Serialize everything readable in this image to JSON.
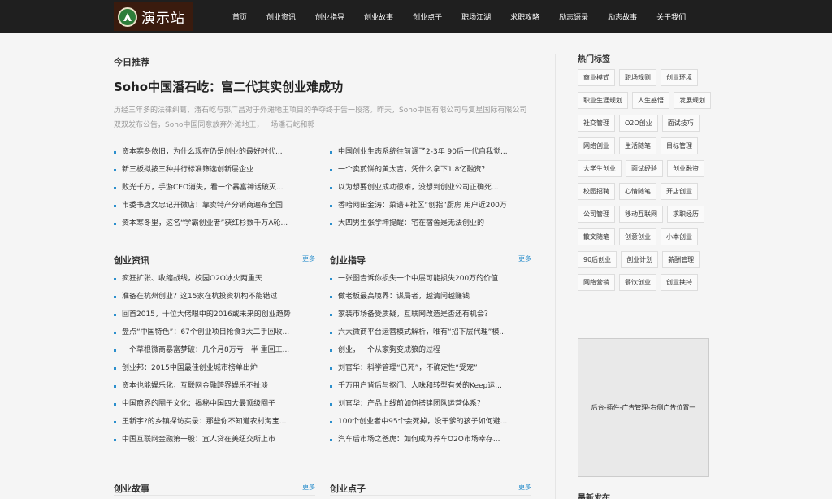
{
  "logo": {
    "text": "演示站"
  },
  "nav": [
    "首页",
    "创业资讯",
    "创业指导",
    "创业故事",
    "创业点子",
    "职场江湖",
    "求职攻略",
    "励志语录",
    "励志故事",
    "关于我们"
  ],
  "recommend": {
    "title": "今日推荐",
    "headline": "Soho中国潘石屹：富二代其实创业难成功",
    "summary": "历经三年多的法律纠葛，潘石屹与郭广昌对于外滩地王项目的争夺终于告一段落。昨天，Soho中国有限公司与复星国际有限公司双双发布公告，Soho中国同意放弃外滩地王，一场潘石屹和郭",
    "left": [
      "资本寒冬依旧，为什么现在仍是创业的最好时代...",
      "新三板拟按三种并行标准筛选创新层企业",
      "败光千万，手游CEO消失，看一个暴富神话破灭...",
      "市委书唐文忠记开微店！靠卖特产分销商遍布全国",
      "资本寒冬里，这名“学霸创业者”获红杉数千万A轮..."
    ],
    "right": [
      "中国创业生态系统往前调了2-3年 90后一代自我觉...",
      "一个卖煎饼的黄太吉，凭什么拿下1.8亿融资？",
      "以为想要创业成功很难，没想到创业公司正确死...",
      "香哈网田金涛：菜谱+社区“创指”厨房 用户近200万",
      "大四男生张学坤提醒：宅在宿舍是无法创业的"
    ]
  },
  "sections": [
    {
      "title": "创业资讯",
      "more": "更多",
      "items": [
        "疯狂扩张、收缩战线，校园O2O冰火两重天",
        "准备在杭州创业？这15家在杭投资机构不能错过",
        "回首2015，十位大佬眼中的2016或未来的创业趋势",
        "盘点“中国特色”：67个创业项目抢食3大二手回收...",
        "一个草根微商暴富梦破：几个月8万亏一半 重回工...",
        "创业邦：2015中国最佳创业城市榜单出炉",
        "资本也能娱乐化，互联网金融跨界娱乐不扯淡",
        "中国商界的圈子文化：揭秘中国四大最顶级圈子",
        "王新宇?的乡镇探访实录：那些你不知道农村淘宝...",
        "中国互联网金融第一股：宜人贷在美纽交所上市"
      ]
    },
    {
      "title": "创业指导",
      "more": "更多",
      "items": [
        "一张图告诉你损失一个中层可能损失200万的价值",
        "做老板最高境界：谋局者，越清闲越赚钱",
        "家装市场备受质疑，互联网改造是否还有机会？",
        "六大微商平台运营模式解析，唯有“招下层代理”模...",
        "创业，一个从家狗变成狼的过程",
        "刘官华：科学管理“已死”，不确定性“受宠”",
        "千万用户背后与抠门、人味和转型有关的Keep运...",
        "刘官华：产品上线前如何搭建团队运营体系？",
        "100个创业者中95个会死掉，没干爹的孩子如何避...",
        "汽车后市场之爸虎：如何成为养车O2O市场幸存..."
      ]
    },
    {
      "title": "创业故事",
      "more": "更多"
    },
    {
      "title": "创业点子",
      "more": "更多"
    }
  ],
  "sidebar": {
    "tags_title": "热门标签",
    "tags": [
      "商业模式",
      "职场规则",
      "创业环境",
      "职业生涯规划",
      "人生感悟",
      "发展规划",
      "社交管理",
      "O2O创业",
      "面试技巧",
      "网络创业",
      "生活随笔",
      "目标管理",
      "大学生创业",
      "面试经验",
      "创业融资",
      "校园招聘",
      "心情随笔",
      "开店创业",
      "公司管理",
      "移动互联网",
      "求职经历",
      "散文随笔",
      "创意创业",
      "小本创业",
      "90后创业",
      "创业计划",
      "薪酬管理",
      "网络营销",
      "餐饮创业",
      "创业扶持"
    ],
    "ad_text": "后台-插件-广告管理-右侧广告位置一",
    "latest_title": "最新发布"
  }
}
